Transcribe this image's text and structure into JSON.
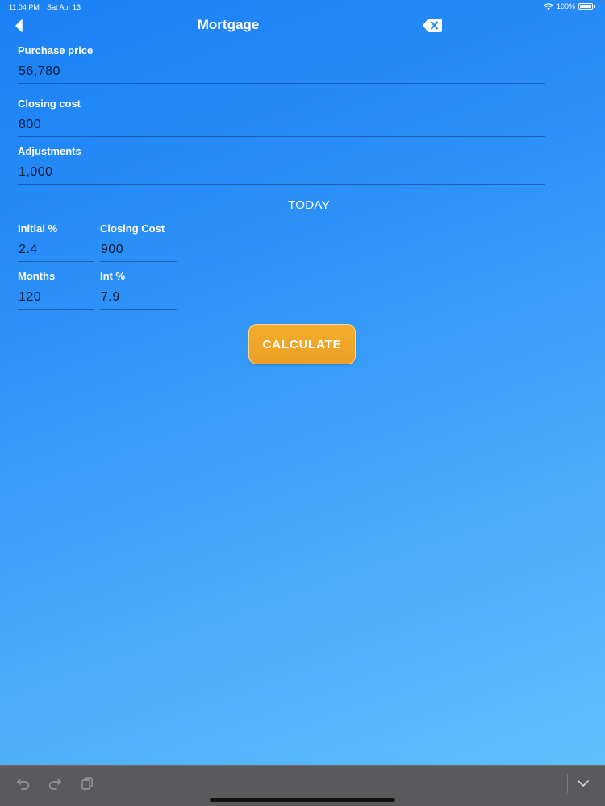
{
  "status_bar": {
    "time": "11:04 PM",
    "date": "Sat Apr 13",
    "battery": "100%",
    "battery_level": 1.0
  },
  "nav": {
    "title": "Mortgage",
    "back_icon": "chevron-left-icon",
    "clear_icon": "backspace-icon"
  },
  "form": {
    "purchase_price": {
      "label": "Purchase price",
      "value": "56,780"
    },
    "closing_cost": {
      "label": "Closing cost",
      "value": "800"
    },
    "adjustments": {
      "label": "Adjustments",
      "value": "1,000"
    }
  },
  "section_title": "TODAY",
  "today": {
    "initial_pct": {
      "label": "Initial %",
      "value": "2.4"
    },
    "closing_cost": {
      "label": "Closing Cost",
      "value": "900"
    },
    "months": {
      "label": "Months",
      "value": "120"
    },
    "int_pct": {
      "label": "Int %",
      "value": "7.9"
    }
  },
  "calculate_label": "CALCULATE",
  "colors": {
    "background_start": "#1a80f6",
    "background_end": "#62c3fd",
    "button": "#eea326",
    "toolbar": "#5a5a5c",
    "text": "#ffffff",
    "value_text": "#0b1a33"
  },
  "toolbar": {
    "icons": [
      "undo-icon",
      "redo-icon",
      "paste-icon",
      "keyboard-dismiss-icon"
    ]
  }
}
